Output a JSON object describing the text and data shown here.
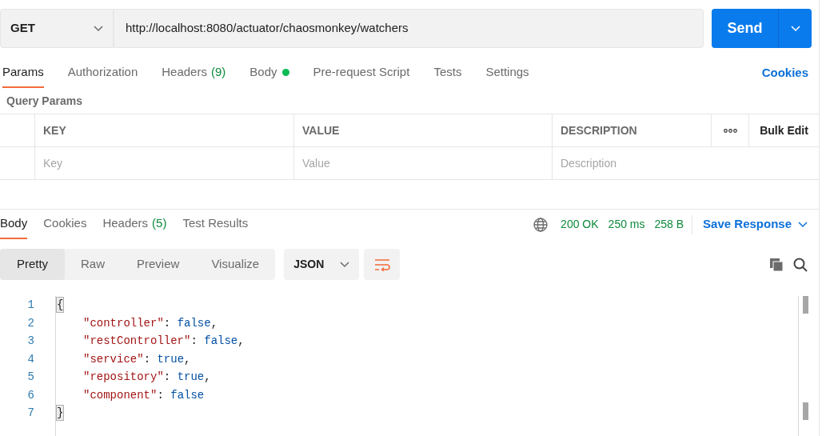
{
  "request": {
    "method": "GET",
    "url": "http://localhost:8080/actuator/chaosmonkey/watchers",
    "send": "Send"
  },
  "request_tabs": [
    {
      "label": "Params",
      "selected": true
    },
    {
      "label": "Authorization",
      "selected": false
    },
    {
      "label": "Headers",
      "count": "(9)",
      "selected": false
    },
    {
      "label": "Body",
      "dot": true,
      "selected": false
    },
    {
      "label": "Pre-request Script",
      "selected": false
    },
    {
      "label": "Tests",
      "selected": false
    },
    {
      "label": "Settings",
      "selected": false
    }
  ],
  "cookies_link": "Cookies",
  "query_params": {
    "title": "Query Params",
    "columns": [
      "KEY",
      "VALUE",
      "DESCRIPTION"
    ],
    "bulk_edit": "Bulk Edit",
    "placeholders": [
      "Key",
      "Value",
      "Description"
    ]
  },
  "response_tabs": [
    {
      "label": "Body",
      "selected": true
    },
    {
      "label": "Cookies",
      "selected": false
    },
    {
      "label": "Headers",
      "count": "(5)",
      "selected": false
    },
    {
      "label": "Test Results",
      "selected": false
    }
  ],
  "response_status": {
    "status": "200 OK",
    "time": "250 ms",
    "size": "258 B",
    "save": "Save Response"
  },
  "view_modes": [
    {
      "label": "Pretty",
      "selected": true
    },
    {
      "label": "Raw",
      "selected": false
    },
    {
      "label": "Preview",
      "selected": false
    },
    {
      "label": "Visualize",
      "selected": false
    }
  ],
  "format": "JSON",
  "code_lines": [
    {
      "number": "1",
      "tokens": [
        {
          "kind": "brace",
          "text": "{",
          "highlighted": true
        }
      ]
    },
    {
      "number": "2",
      "tokens": [
        {
          "kind": "key",
          "text": "\"controller\""
        },
        {
          "kind": "punct",
          "text": ": "
        },
        {
          "kind": "bool",
          "text": "false"
        },
        {
          "kind": "punct",
          "text": ","
        }
      ]
    },
    {
      "number": "3",
      "tokens": [
        {
          "kind": "key",
          "text": "\"restController\""
        },
        {
          "kind": "punct",
          "text": ": "
        },
        {
          "kind": "bool",
          "text": "false"
        },
        {
          "kind": "punct",
          "text": ","
        }
      ]
    },
    {
      "number": "4",
      "tokens": [
        {
          "kind": "key",
          "text": "\"service\""
        },
        {
          "kind": "punct",
          "text": ": "
        },
        {
          "kind": "bool",
          "text": "true"
        },
        {
          "kind": "punct",
          "text": ","
        }
      ]
    },
    {
      "number": "5",
      "tokens": [
        {
          "kind": "key",
          "text": "\"repository\""
        },
        {
          "kind": "punct",
          "text": ": "
        },
        {
          "kind": "bool",
          "text": "true"
        },
        {
          "kind": "punct",
          "text": ","
        }
      ]
    },
    {
      "number": "6",
      "tokens": [
        {
          "kind": "key",
          "text": "\"component\""
        },
        {
          "kind": "punct",
          "text": ": "
        },
        {
          "kind": "bool",
          "text": "false"
        }
      ]
    },
    {
      "number": "7",
      "tokens": [
        {
          "kind": "brace",
          "text": "}",
          "highlighted": true
        }
      ]
    }
  ]
}
